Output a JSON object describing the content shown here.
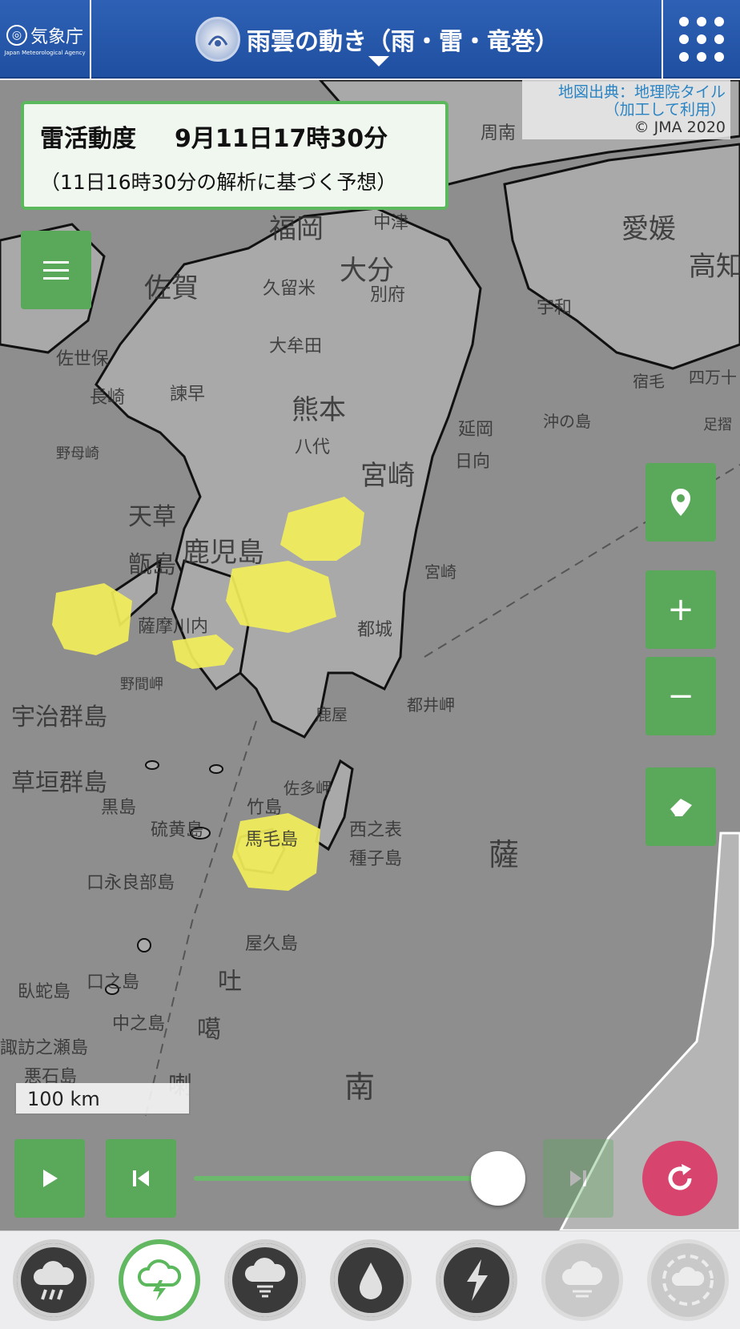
{
  "header": {
    "logo_jp": "気象庁",
    "logo_en": "Japan Meteorological Agency",
    "title": "雨雲の動き（雨・雷・竜巻）"
  },
  "attribution": {
    "line1": "地図出典：地理院タイル",
    "line2": "（加工して利用）",
    "line3": "© JMA 2020"
  },
  "info": {
    "element": "雷活動度",
    "datetime": "9月11日17時30分",
    "basis": "（11日16時30分の解析に基づく予想）"
  },
  "map_labels": [
    "福岡",
    "佐賀",
    "大分",
    "熊本",
    "宮崎",
    "鹿児島",
    "愛媛",
    "高知",
    "中津",
    "別府",
    "久留米",
    "大牟田",
    "八代",
    "延岡",
    "日向",
    "都城",
    "宇和",
    "薩摩川内",
    "佐世保",
    "長崎",
    "諫早",
    "宇治群島",
    "草垣群島",
    "黒島",
    "硫黄島",
    "竹島",
    "馬毛島",
    "西之表",
    "種子島",
    "屋久島",
    "口永良部島",
    "口之島",
    "中之島",
    "臥蛇島",
    "諏訪之瀬島",
    "悪石島",
    "佐多岬",
    "都井岬",
    "甑島",
    "天草",
    "薩",
    "南",
    "吐",
    "噶",
    "喇",
    "四万十",
    "宿毛",
    "沖の島",
    "宮崎",
    "鹿屋",
    "野母崎",
    "野間岬",
    "周南",
    "足摺"
  ],
  "scale": "100 km",
  "icons": {
    "location": "location-pin-icon",
    "zoom_in": "+",
    "zoom_out": "−",
    "layers": "eraser-icon",
    "play": "play-icon",
    "step_back": "step-back-icon",
    "step_forward": "step-forward-icon",
    "refresh": "refresh-icon"
  },
  "slider": {
    "position_fraction": 0.9
  },
  "bottom_tabs": [
    {
      "name": "rain-cloud-icon",
      "active": false
    },
    {
      "name": "thunder-cloud-icon",
      "active": true
    },
    {
      "name": "tornado-cloud-icon",
      "active": false
    },
    {
      "name": "raindrop-icon",
      "active": false
    },
    {
      "name": "lightning-icon",
      "active": false
    },
    {
      "name": "snow-cloud-icon",
      "active": false
    },
    {
      "name": "dashed-cloud-icon",
      "active": false
    }
  ],
  "colors": {
    "header": "#2e61b5",
    "green": "#5aa85a",
    "thunder_yellow": "#f2ee5a",
    "refresh": "#d7456f"
  }
}
